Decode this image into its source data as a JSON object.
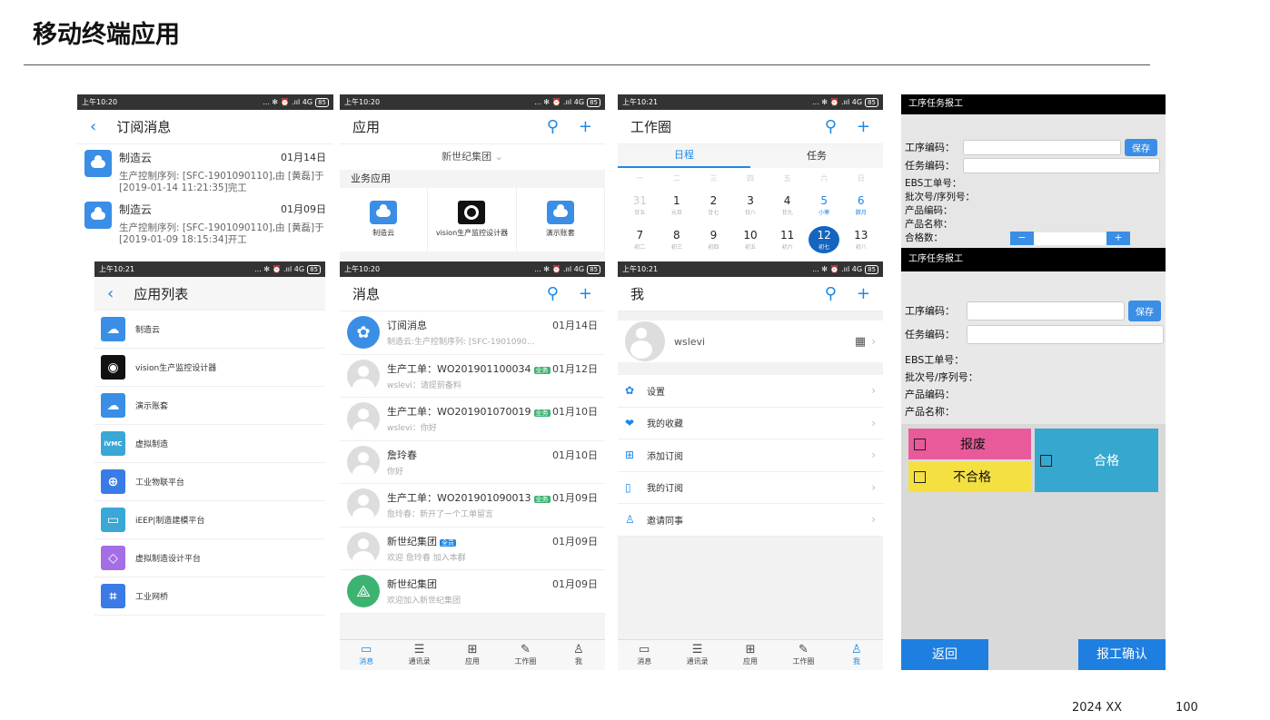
{
  "slide": {
    "title": "移动终端应用",
    "footer_left": "2024 XX",
    "footer_right": "100"
  },
  "status": {
    "t1": "上午10:20",
    "t2": "上午10:21",
    "icons": "... ✻ ⏰ .ııl 4G",
    "battery": "85"
  },
  "sub": {
    "title": "订阅消息",
    "items": [
      {
        "name": "制造云",
        "date": "01月14日",
        "text": "生产控制序列: [SFC-1901090110],由 [黄磊]于[2019-01-14 11:21:35]完工"
      },
      {
        "name": "制造云",
        "date": "01月09日",
        "text": "生产控制序列: [SFC-1901090110],由 [黄磊]于[2019-01-09 18:15:34]开工"
      }
    ]
  },
  "apps": {
    "title": "应用",
    "group": "新世纪集团",
    "section": "业务应用",
    "items": [
      {
        "label": "制造云"
      },
      {
        "label": "vision生产监控设计器"
      },
      {
        "label": "演示账套"
      }
    ]
  },
  "circle": {
    "title": "工作圈",
    "tab1": "日程",
    "tab2": "任务",
    "weekdays": [
      "一",
      "二",
      "三",
      "四",
      "五",
      "六",
      "日"
    ],
    "week1": [
      {
        "d": "31",
        "l": "廿五"
      },
      {
        "d": "1",
        "l": "元旦"
      },
      {
        "d": "2",
        "l": "廿七"
      },
      {
        "d": "3",
        "l": "廿八"
      },
      {
        "d": "4",
        "l": "廿九"
      },
      {
        "d": "5",
        "l": "小寒"
      },
      {
        "d": "6",
        "l": "腊月"
      }
    ],
    "week2": [
      {
        "d": "7",
        "l": "初二"
      },
      {
        "d": "8",
        "l": "初三"
      },
      {
        "d": "9",
        "l": "初四"
      },
      {
        "d": "10",
        "l": "初五"
      },
      {
        "d": "11",
        "l": "初六"
      },
      {
        "d": "12",
        "l": "初七"
      },
      {
        "d": "13",
        "l": "初八"
      }
    ]
  },
  "form1": {
    "header": "工序任务报工",
    "proc": "工序编码：",
    "save": "保存",
    "task": "任务编码：",
    "ebs": "EBS工单号：",
    "batch": "批次号/序列号：",
    "prod_code": "产品编码：",
    "prod_name": "产品名称：",
    "qualified_qty": "合格数："
  },
  "applist": {
    "title": "应用列表",
    "items": [
      {
        "label": "制造云",
        "icon": "cloud-icon"
      },
      {
        "label": "vision生产监控设计器",
        "icon": "vision-icon"
      },
      {
        "label": "演示账套",
        "icon": "cloud-icon"
      },
      {
        "label": "虚拟制造",
        "icon": "ivmc-icon"
      },
      {
        "label": "工业物联平台",
        "icon": "globe-icon"
      },
      {
        "label": "iEEP|制造建模平台",
        "icon": "monitor-icon"
      },
      {
        "label": "虚拟制造设计平台",
        "icon": "diamond-icon"
      },
      {
        "label": "工业网桥",
        "icon": "network-icon"
      }
    ]
  },
  "msgs": {
    "title": "消息",
    "items": [
      {
        "name": "订阅消息",
        "date": "01月14日",
        "sub": "制造云:生产控制序列: [SFC-1901090...",
        "badge": "",
        "av": "sub"
      },
      {
        "name": "生产工单：WO201901100034",
        "date": "01月12日",
        "sub": "wslevi：请提前备料",
        "badge": "业务",
        "av": "user"
      },
      {
        "name": "生产工单：WO201901070019",
        "date": "01月10日",
        "sub": "wslevi：你好",
        "badge": "业务",
        "av": "user"
      },
      {
        "name": "詹玲春",
        "date": "01月10日",
        "sub": "你好",
        "badge": "",
        "av": "user"
      },
      {
        "name": "生产工单：WO201901090013",
        "date": "01月09日",
        "sub": "詹玲春：新开了一个工单留言",
        "badge": "业务",
        "av": "user"
      },
      {
        "name": "新世纪集团",
        "date": "01月09日",
        "sub": "欢迎 詹玲春 加入本群",
        "badge": "全员",
        "av": "user"
      },
      {
        "name": "新世纪集团",
        "date": "01月09日",
        "sub": "欢迎加入新世纪集团",
        "badge": "",
        "av": "group"
      }
    ]
  },
  "tabs": [
    "消息",
    "通讯录",
    "应用",
    "工作圈",
    "我"
  ],
  "me": {
    "title": "我",
    "user": "wslevi",
    "items": [
      {
        "label": "设置",
        "icon": "gear-icon",
        "glyph": "✿"
      },
      {
        "label": "我的收藏",
        "icon": "heart-icon",
        "glyph": "❤"
      },
      {
        "label": "添加订阅",
        "icon": "add-sub-icon",
        "glyph": "⊞"
      },
      {
        "label": "我的订阅",
        "icon": "bookmark-icon",
        "glyph": "▯"
      },
      {
        "label": "邀请同事",
        "icon": "person-icon",
        "glyph": "♙"
      }
    ]
  },
  "form2": {
    "header": "工序任务报工",
    "proc": "工序编码：",
    "save": "保存",
    "task": "任务编码：",
    "ebs": "EBS工单号：",
    "batch": "批次号/序列号：",
    "prod_code": "产品编码：",
    "prod_name": "产品名称：",
    "scrap": "报废",
    "unqualified": "不合格",
    "qualified": "合格",
    "back": "返回",
    "confirm": "报工确认"
  }
}
